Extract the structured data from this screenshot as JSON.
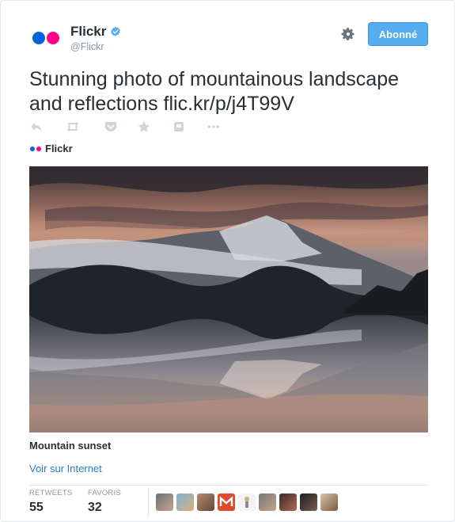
{
  "account": {
    "name": "Flickr",
    "handle": "@Flickr",
    "follow_label": "Abonné",
    "brand_colors": {
      "blue": "#0063dc",
      "pink": "#ff0084"
    }
  },
  "tweet": {
    "text": "Stunning photo of mountainous landscape and reflections flic.kr/p/j4T99V"
  },
  "actions": [
    "reply-icon",
    "retweet-icon",
    "pocket-icon",
    "favorite-icon",
    "card-icon",
    "more-icon"
  ],
  "card": {
    "source_name": "Flickr",
    "photo_title": "Mountain sunset",
    "link_label": "Voir sur Internet"
  },
  "stats": {
    "retweets_label": "RETWEETS",
    "retweets_value": "55",
    "favorites_label": "FAVORIS",
    "favorites_value": "32"
  },
  "colors": {
    "accent": "#55acee",
    "link": "#2b7bb9",
    "muted": "#8899a6"
  }
}
